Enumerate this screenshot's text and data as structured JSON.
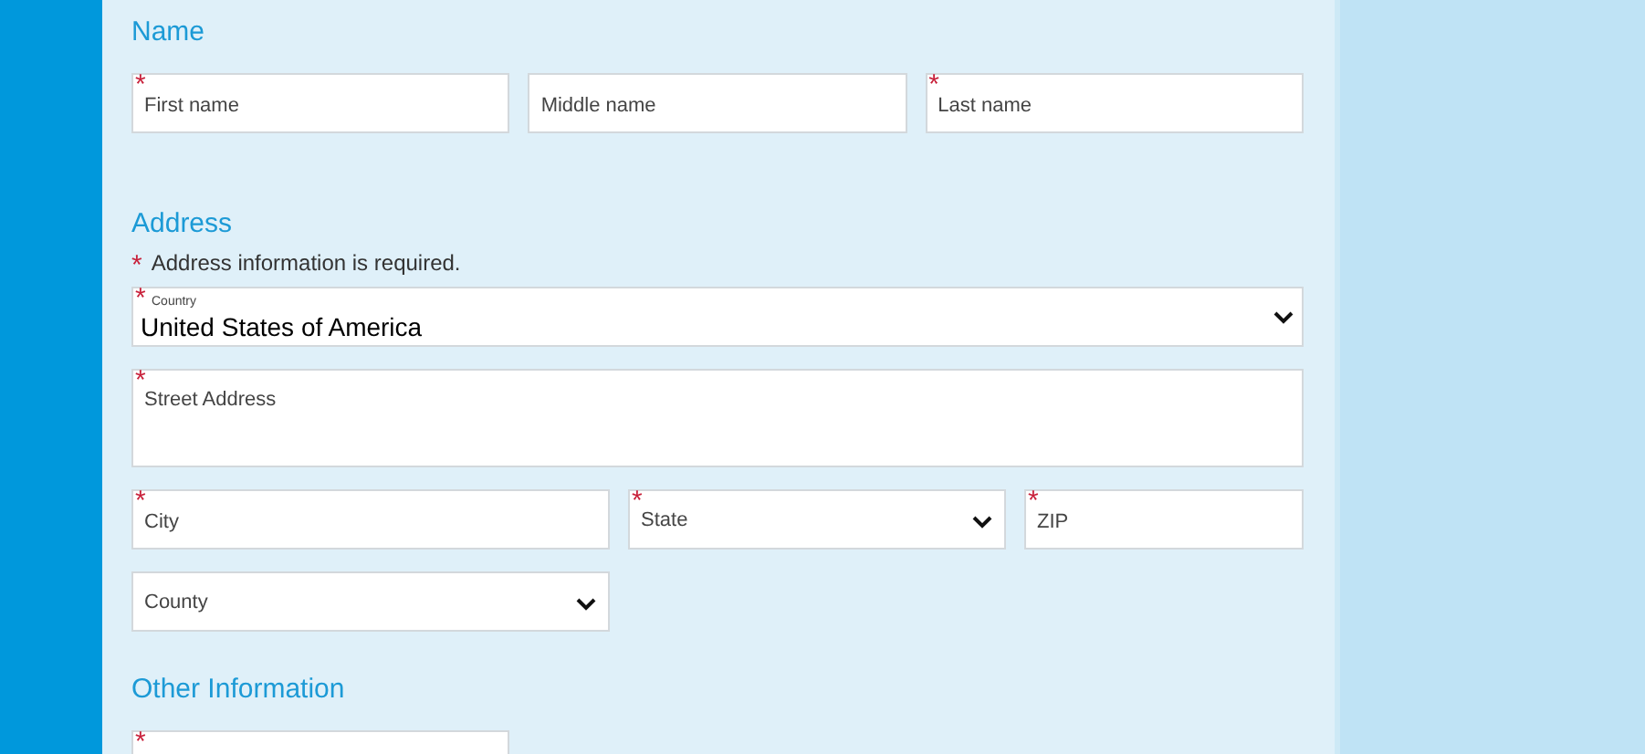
{
  "sections": [
    {
      "title": "Name",
      "rows": [
        [
          {
            "kind": "input",
            "required_mark": "*",
            "placeholder": "First name"
          },
          {
            "kind": "input",
            "placeholder": "Middle name"
          },
          {
            "kind": "input",
            "required_mark": "*",
            "placeholder": "Last name"
          }
        ]
      ]
    },
    {
      "title": "Address",
      "note": {
        "required_mark": "*",
        "text": "Address information is required."
      },
      "rows": [
        [
          {
            "kind": "select",
            "required_mark": "*",
            "label": "Country",
            "value": "United States of America"
          }
        ],
        [
          {
            "kind": "textarea",
            "required_mark": "*",
            "placeholder": "Street Address"
          }
        ],
        [
          {
            "kind": "input",
            "required_mark": "*",
            "placeholder": "City"
          },
          {
            "kind": "select",
            "required_mark": "*",
            "placeholder": "State"
          },
          {
            "kind": "input",
            "required_mark": "*",
            "placeholder": "ZIP"
          }
        ],
        [
          {
            "kind": "select",
            "placeholder": "County"
          },
          {
            "kind": "spacer"
          }
        ]
      ]
    },
    {
      "title": "Other Information",
      "rows": [
        [
          {
            "kind": "input",
            "required_mark": "*"
          },
          {
            "kind": "spacer"
          },
          {
            "kind": "spacer"
          }
        ]
      ]
    }
  ]
}
